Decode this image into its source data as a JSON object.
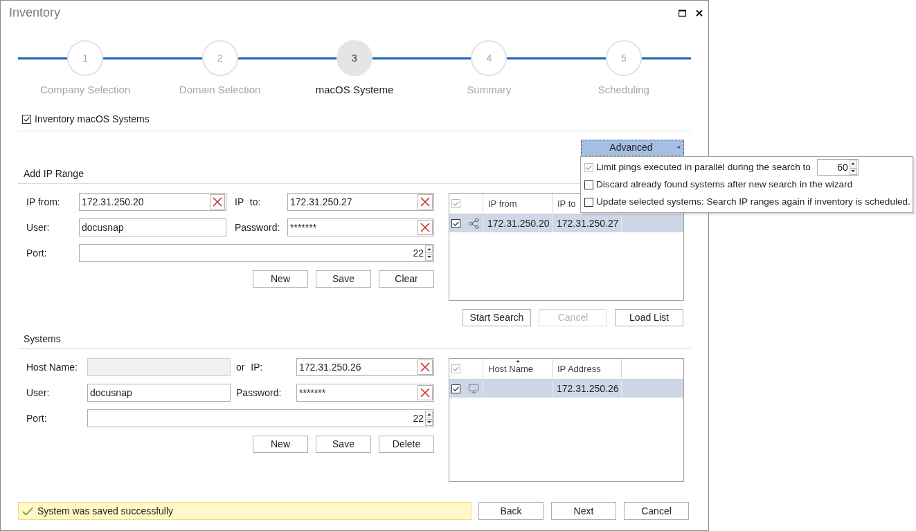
{
  "window": {
    "title": "Inventory"
  },
  "steps": [
    {
      "number": "1",
      "label": "Company Selection",
      "selected": false
    },
    {
      "number": "2",
      "label": "Domain Selection",
      "selected": false
    },
    {
      "number": "3",
      "label": "macOS Systeme",
      "selected": true
    },
    {
      "number": "4",
      "label": "Summary",
      "selected": false
    },
    {
      "number": "5",
      "label": "Scheduling",
      "selected": false
    }
  ],
  "inventory_option": {
    "label": "Inventory macOS Systems",
    "checked": true
  },
  "advanced": {
    "button": "Advanced",
    "items": [
      {
        "kind": "spinner",
        "label": "Limit pings executed in parallel during the search to",
        "checked": true,
        "disabled": true,
        "value": "60"
      },
      {
        "kind": "check",
        "label": "Discard already found systems after new search in the wizard",
        "checked": false,
        "disabled": false
      },
      {
        "kind": "check",
        "label": "Update selected systems: Search IP ranges again if inventory is scheduled.",
        "checked": false,
        "disabled": false
      }
    ]
  },
  "ip_range": {
    "heading": "Add IP Range",
    "fields": [
      {
        "label": "IP from:",
        "value": "172.31.250.20",
        "clearable": true,
        "disabled": false
      },
      {
        "label": "IP to:",
        "value": "172.31.250.27",
        "clearable": true,
        "disabled": false
      },
      {
        "label": "User:",
        "value": "docusnap",
        "clearable": false,
        "disabled": false
      },
      {
        "label": "Password:",
        "value": "*******",
        "clearable": true,
        "disabled": false
      }
    ],
    "port": {
      "label": "Port:",
      "value": "22"
    },
    "buttons": [
      {
        "label": "New",
        "disabled": false
      },
      {
        "label": "Save",
        "disabled": false
      },
      {
        "label": "Clear",
        "disabled": false
      }
    ],
    "table": {
      "select_all": {
        "checked": true,
        "disabled": true
      },
      "columns": [
        {
          "label": "IP from"
        },
        {
          "label": "IP to"
        }
      ],
      "rows": [
        {
          "checked": true,
          "selected": true,
          "cells": [
            {
              "text": "172.31.250.20"
            },
            {
              "text": "172.31.250.27"
            }
          ]
        }
      ]
    },
    "table_buttons": [
      {
        "label": "Start Search",
        "disabled": false
      },
      {
        "label": "Cancel",
        "disabled": true
      },
      {
        "label": "Load List",
        "disabled": false
      }
    ]
  },
  "systems": {
    "heading": "Systems",
    "fields": [
      {
        "label": "Host Name:",
        "clearable": false,
        "disabled": true
      },
      {
        "label": "or IP:",
        "value": "172.31.250.26",
        "clearable": true,
        "disabled": false
      },
      {
        "label": "User:",
        "value": "docusnap",
        "clearable": false,
        "disabled": false
      },
      {
        "label": "Password:",
        "value": "*******",
        "clearable": true,
        "disabled": false
      }
    ],
    "port": {
      "label": "Port:",
      "value": "22"
    },
    "buttons": [
      {
        "label": "New",
        "disabled": false
      },
      {
        "label": "Save",
        "disabled": false
      },
      {
        "label": "Delete",
        "disabled": false
      }
    ],
    "table": {
      "select_all": {
        "checked": true,
        "disabled": true
      },
      "columns": [
        {
          "label": "Host Name",
          "sorted": true
        },
        {
          "label": "IP Address",
          "sorted": false
        }
      ],
      "rows": [
        {
          "checked": true,
          "selected": true,
          "cells": [
            {},
            {
              "text": "172.31.250.26"
            }
          ]
        }
      ]
    }
  },
  "status": {
    "message": "System was saved successfully"
  },
  "nav_buttons": [
    {
      "label": "Back",
      "disabled": false
    },
    {
      "label": "Next",
      "disabled": false
    },
    {
      "label": "Cancel",
      "disabled": false
    }
  ]
}
